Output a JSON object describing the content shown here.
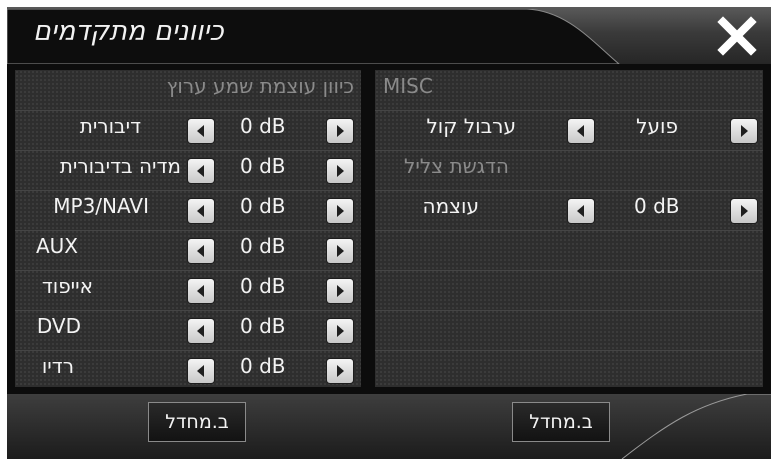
{
  "header": {
    "title": "כיוונים מתקדמים"
  },
  "left_panel": {
    "title": "כיוון עוצמת שמע ערוץ",
    "rows": [
      {
        "label": "דיבורית",
        "value": "0 dB"
      },
      {
        "label": "מדיה בדיבורית",
        "value": "0 dB"
      },
      {
        "label": "MP3/NAVI",
        "value": "0 dB"
      },
      {
        "label": "AUX",
        "value": "0 dB"
      },
      {
        "label": "אייפוד",
        "value": "0 dB"
      },
      {
        "label": "DVD",
        "value": "0 dB"
      },
      {
        "label": "רדיו",
        "value": "0 dB"
      }
    ]
  },
  "right_panel": {
    "title": "MISC",
    "mix": {
      "label": "ערבול קול",
      "value": "פועל"
    },
    "bass_title": "הדגשת צליל",
    "gain": {
      "label": "עוצמה",
      "value": "0 dB"
    }
  },
  "footer": {
    "left_default_label": "ב.מחדל",
    "right_default_label": "ב.מחדל"
  },
  "colors": {
    "panel_bg": "#2e2e2e",
    "section_label": "#8a8a8a",
    "text": "#f3f3f3",
    "button_face": "#e0e0e0"
  },
  "icons": {
    "close": "close-x-icon",
    "decrease": "arrow-left-icon",
    "increase": "arrow-right-icon"
  }
}
